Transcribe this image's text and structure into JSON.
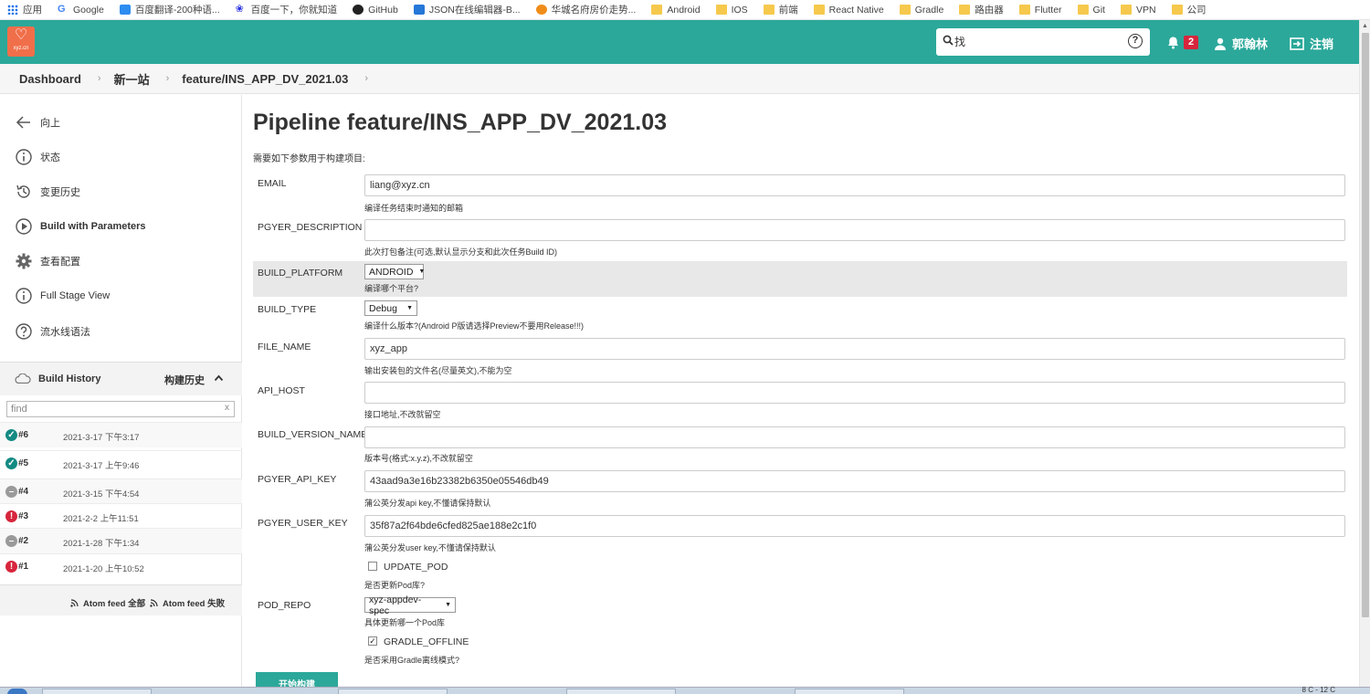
{
  "bookmarks": [
    {
      "label": "应用",
      "icon": "apps-icon"
    },
    {
      "label": "Google",
      "icon": "google-icon"
    },
    {
      "label": "百度翻译-200种语...",
      "icon": "translate-icon"
    },
    {
      "label": "百度一下，你就知道",
      "icon": "baidu-icon"
    },
    {
      "label": "GitHub",
      "icon": "github-icon"
    },
    {
      "label": "JSON在线编辑器-B...",
      "icon": "json-icon"
    },
    {
      "label": "华城名府房价走势...",
      "icon": "house-icon"
    },
    {
      "label": "Android",
      "icon": "folder-icon"
    },
    {
      "label": "IOS",
      "icon": "folder-icon"
    },
    {
      "label": "前端",
      "icon": "folder-icon"
    },
    {
      "label": "React Native",
      "icon": "folder-icon"
    },
    {
      "label": "Gradle",
      "icon": "folder-icon"
    },
    {
      "label": "路由器",
      "icon": "folder-icon"
    },
    {
      "label": "Flutter",
      "icon": "folder-icon"
    },
    {
      "label": "Git",
      "icon": "folder-icon"
    },
    {
      "label": "VPN",
      "icon": "folder-icon"
    },
    {
      "label": "公司",
      "icon": "folder-icon"
    }
  ],
  "header": {
    "logo_text": "xyz.cn",
    "search_placeholder": "找",
    "notification_count": "2",
    "user_name": "郭翰林",
    "logout_label": "注销",
    "colors": {
      "header_bg": "#2ba89a",
      "badge": "#d7253c",
      "logo": "#f06f4a"
    }
  },
  "breadcrumbs": [
    "Dashboard",
    "新一站",
    "feature/INS_APP_DV_2021.03"
  ],
  "sidebar": {
    "tasks": [
      {
        "label": "向上",
        "icon": "arrow-left-icon"
      },
      {
        "label": "状态",
        "icon": "info-icon"
      },
      {
        "label": "变更历史",
        "icon": "history-icon"
      },
      {
        "label": "Build with Parameters",
        "icon": "play-icon"
      },
      {
        "label": "查看配置",
        "icon": "gear-icon"
      },
      {
        "label": "Full Stage View",
        "icon": "info-icon"
      },
      {
        "label": "流水线语法",
        "icon": "help-icon"
      }
    ],
    "build_history": {
      "title": "Build History",
      "title_cn": "构建历史",
      "find_placeholder": "find",
      "clear_label": "x",
      "builds": [
        {
          "number": "#6",
          "date": "2021-3-17 下午3:17",
          "status": "success"
        },
        {
          "number": "#5",
          "date": "2021-3-17 上午9:46",
          "status": "success"
        },
        {
          "number": "#4",
          "date": "2021-3-15 下午4:54",
          "status": "aborted"
        },
        {
          "number": "#3",
          "date": "2021-2-2 上午11:51",
          "status": "failed"
        },
        {
          "number": "#2",
          "date": "2021-1-28 下午1:34",
          "status": "aborted"
        },
        {
          "number": "#1",
          "date": "2021-1-20 上午10:52",
          "status": "failed"
        }
      ],
      "feed_all": "Atom feed 全部",
      "feed_failed": "Atom feed 失败"
    }
  },
  "main": {
    "title": "Pipeline feature/INS_APP_DV_2021.03",
    "intro": "需要如下参数用于构建项目:",
    "params": {
      "email": {
        "name": "EMAIL",
        "value": "liang@xyz.cn",
        "description": "编译任务结束时通知的邮箱"
      },
      "pgyer_description": {
        "name": "PGYER_DESCRIPTION",
        "value": "",
        "description": "此次打包备注(可选,默认显示分支和此次任务Build ID)"
      },
      "build_platform": {
        "name": "BUILD_PLATFORM",
        "value": "ANDROID",
        "description": "编译哪个平台?"
      },
      "build_type": {
        "name": "BUILD_TYPE",
        "value": "Debug",
        "description": "编译什么版本?(Android P版请选择Preview不要用Release!!!)"
      },
      "file_name": {
        "name": "FILE_NAME",
        "value": "xyz_app",
        "description": "输出安装包的文件名(尽量英文),不能为空"
      },
      "api_host": {
        "name": "API_HOST",
        "value": "",
        "description": "接口地址,不改就留空"
      },
      "build_version_name": {
        "name": "BUILD_VERSION_NAME",
        "value": "",
        "description": "版本号(格式:x.y.z),不改就留空"
      },
      "pgyer_api_key": {
        "name": "PGYER_API_KEY",
        "value": "43aad9a3e16b23382b6350e05546db49",
        "description": "蒲公英分发api key,不懂请保持默认"
      },
      "pgyer_user_key": {
        "name": "PGYER_USER_KEY",
        "value": "35f87a2f64bde6cfed825ae188e2c1f0",
        "description": "蒲公英分发user key,不懂请保持默认"
      },
      "update_pod": {
        "name": "UPDATE_POD",
        "checked": false,
        "description": "是否更新Pod库?"
      },
      "pod_repo": {
        "name": "POD_REPO",
        "value": "xyz-appdev-spec",
        "description": "具体更新哪一个Pod库"
      },
      "gradle_offline": {
        "name": "GRADLE_OFFLINE",
        "checked": true,
        "description": "是否采用Gradle离线模式?"
      }
    },
    "build_button": "开始构建"
  },
  "taskbar": {
    "clock": "8 C - 12 C"
  }
}
